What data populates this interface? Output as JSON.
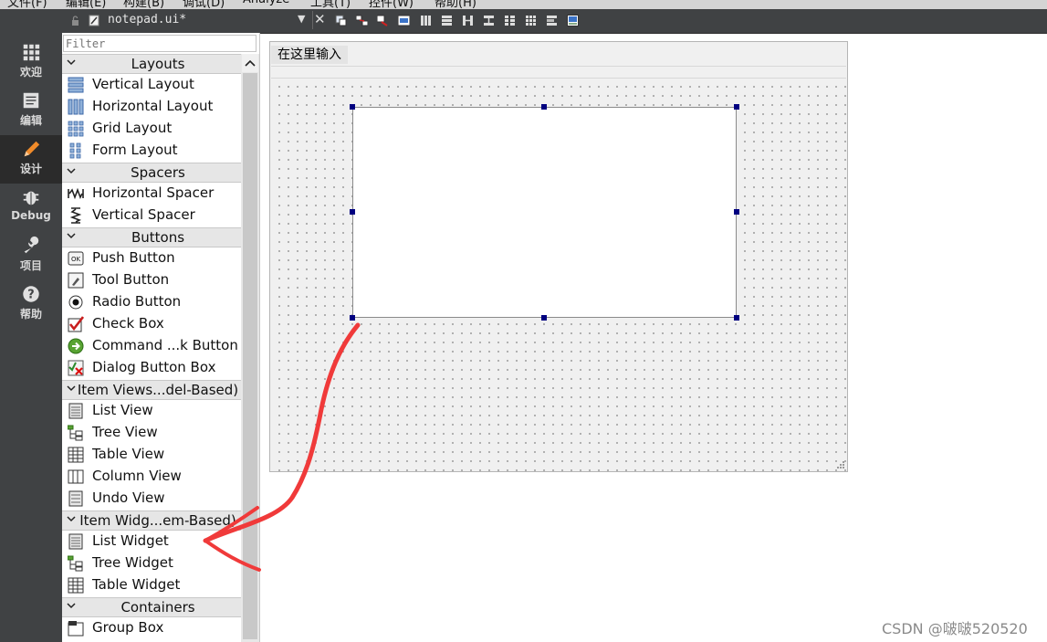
{
  "menubar": [
    "文件(F)",
    "编辑(E)",
    "构建(B)",
    "调试(D)",
    "Analyze",
    "工具(T)",
    "控件(W)",
    "帮助(H)"
  ],
  "modes": [
    {
      "label": "欢迎",
      "icon": "grid-icon"
    },
    {
      "label": "编辑",
      "icon": "document-icon"
    },
    {
      "label": "设计",
      "icon": "pencil-icon",
      "active": true
    },
    {
      "label": "Debug",
      "icon": "bug-icon"
    },
    {
      "label": "项目",
      "icon": "wrench-icon"
    },
    {
      "label": "帮助",
      "icon": "help-icon"
    }
  ],
  "toolbar": {
    "file_name": "notepad.ui*"
  },
  "widgetbox": {
    "filter_placeholder": "Filter",
    "categories": [
      {
        "title": "Layouts",
        "items": [
          "Vertical Layout",
          "Horizontal Layout",
          "Grid Layout",
          "Form Layout"
        ]
      },
      {
        "title": "Spacers",
        "items": [
          "Horizontal Spacer",
          "Vertical Spacer"
        ]
      },
      {
        "title": "Buttons",
        "items": [
          "Push Button",
          "Tool Button",
          "Radio Button",
          "Check Box",
          "Command ...k Button",
          "Dialog Button Box"
        ]
      },
      {
        "title": "Item Views...del-Based)",
        "items": [
          "List View",
          "Tree View",
          "Table View",
          "Column View",
          "Undo View"
        ]
      },
      {
        "title": "Item Widg...em-Based)",
        "items": [
          "List Widget",
          "Tree Widget",
          "Table Widget"
        ]
      },
      {
        "title": "Containers",
        "items": [
          "Group Box"
        ]
      }
    ]
  },
  "form": {
    "menu_placeholder": "在这里输入"
  },
  "watermark": "CSDN @啵啵520520",
  "colors": {
    "annotation_arrow": "#f03a3a",
    "selection_handle": "#000080",
    "sidebar": "#404244"
  }
}
